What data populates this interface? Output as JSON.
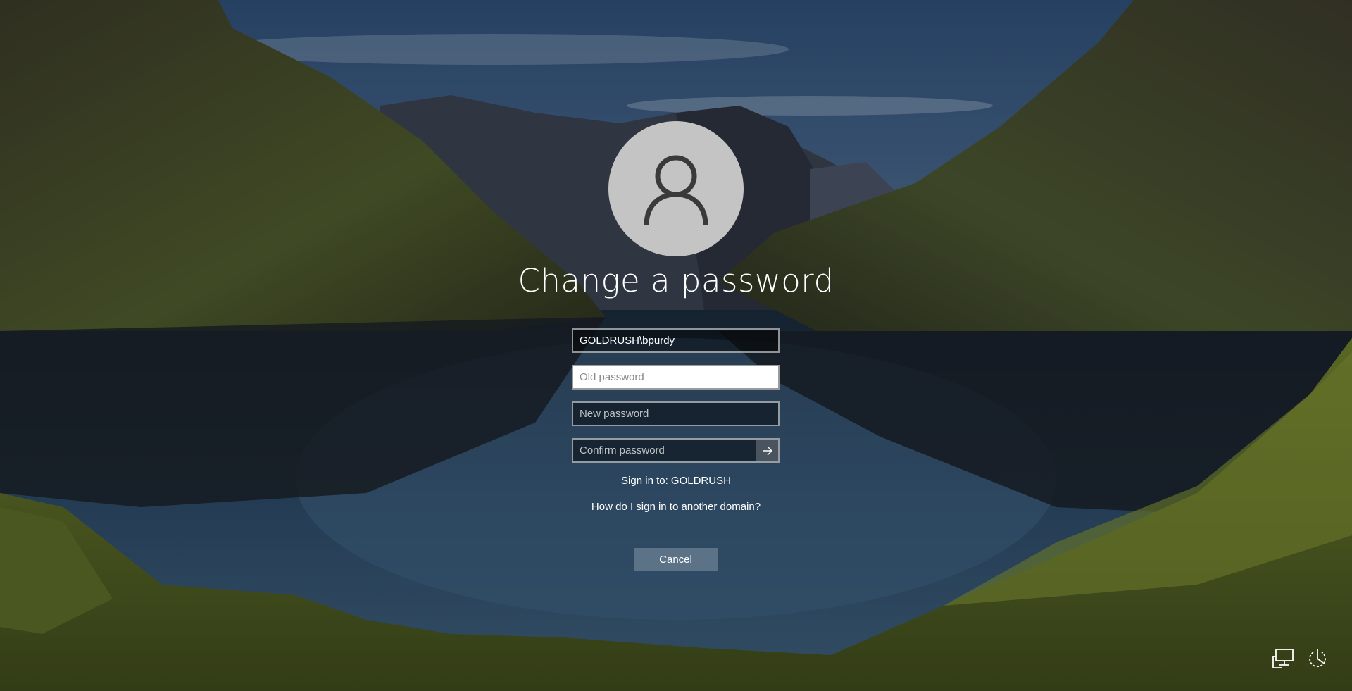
{
  "screen": {
    "title": "Change a password",
    "accent_color": "#ffffff",
    "avatar_icon": "user-silhouette-icon"
  },
  "form": {
    "username_value": "GOLDRUSH\\bpurdy",
    "old_password_placeholder": "Old password",
    "new_password_placeholder": "New password",
    "confirm_password_placeholder": "Confirm password",
    "submit_icon": "arrow-right-icon"
  },
  "sign_in": {
    "domain_text": "Sign in to: GOLDRUSH",
    "other_domain_link": "How do I sign in to another domain?"
  },
  "actions": {
    "cancel_label": "Cancel"
  },
  "tray": {
    "icons": [
      "network-icon",
      "power-icon"
    ]
  }
}
